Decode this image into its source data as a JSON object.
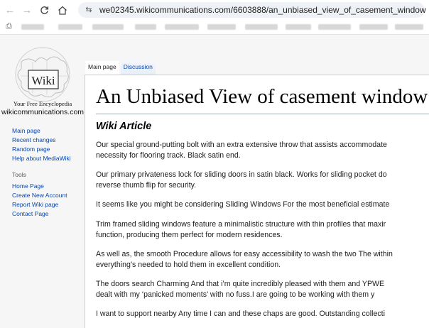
{
  "browser": {
    "url": "we02345.wikicommunications.com/6603888/an_unbiased_view_of_casement_window",
    "back_icon": "back-arrow-icon",
    "forward_icon": "forward-arrow-icon",
    "reload_icon": "reload-icon",
    "home_icon": "home-icon"
  },
  "sidebar": {
    "logo_word": "Wiki",
    "logo_tagline": "Your Free Encyclopedia",
    "site_name": "wikicommunications.com",
    "nav_links": [
      "Main page",
      "Recent changes",
      "Random page",
      "Help about MediaWiki"
    ],
    "tools_title": "Tools",
    "tool_links": [
      "Home Page",
      "Create New Account",
      "Report Wiki page",
      "Contact Page"
    ]
  },
  "tabs": [
    "Main page",
    "Discussion"
  ],
  "article": {
    "title": "An Unbiased View of casement window",
    "section_heading": "Wiki Article",
    "paragraphs": [
      [
        "Our special ground-putting bolt with an extra extensive throw that assists accommodate",
        "necessity for flooring track. Black satin end."
      ],
      [
        "Our primary privateness lock for sliding doors in satin black. Works for sliding pocket do",
        "reverse thumb flip for security."
      ],
      [
        "It seems like you might be considering Sliding Windows For the most beneficial estimate"
      ],
      [
        "Trim framed sliding windows feature a minimalistic structure with thin profiles that maxir",
        "function, producing them perfect for modern residences."
      ],
      [
        "As well as, the smooth Procedure allows for easy accessibility to wash the two The within",
        "everything’s needed to hold them in excellent condition."
      ],
      [
        "The doors search Charming And that i’m quite incredibly pleased with them and YPWE",
        "dealt with my ‘panicked moments’ with no fuss.I are going to be working with them y"
      ],
      [
        "I want to support nearby Any time I can and these chaps are good. Outstanding collecti"
      ]
    ]
  }
}
